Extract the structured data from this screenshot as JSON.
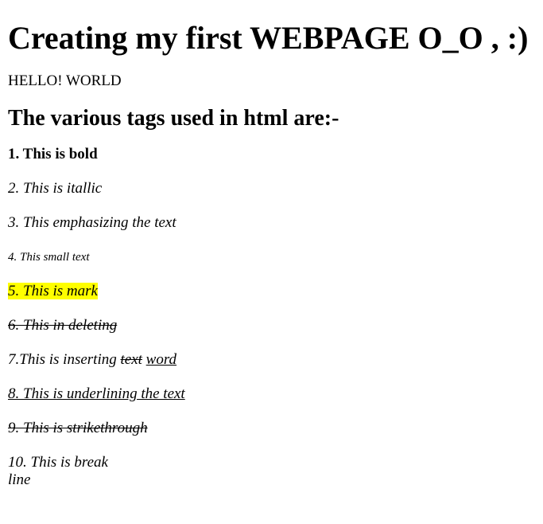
{
  "heading": "Creating my first WEBPAGE O_O , :)",
  "greeting": "HELLO! WORLD",
  "subheading": "The various tags used in html are:-",
  "items": {
    "bold": "1. This is bold",
    "italic": "2. This is itallic",
    "emphasis": "3. This emphasizing the text",
    "small": "4. This small text",
    "mark": "5. This is mark",
    "deleting": "6. This in deleting",
    "inserting_prefix": "7.This is inserting ",
    "inserting_deleted": "text",
    "inserting_inserted": "word",
    "underline": "8. This is underlining the text",
    "strikethrough": "9. This is strikethrough",
    "break_line1": "10. This is break",
    "break_line2": "line"
  },
  "colors": {
    "mark_background": "#ffff00"
  }
}
